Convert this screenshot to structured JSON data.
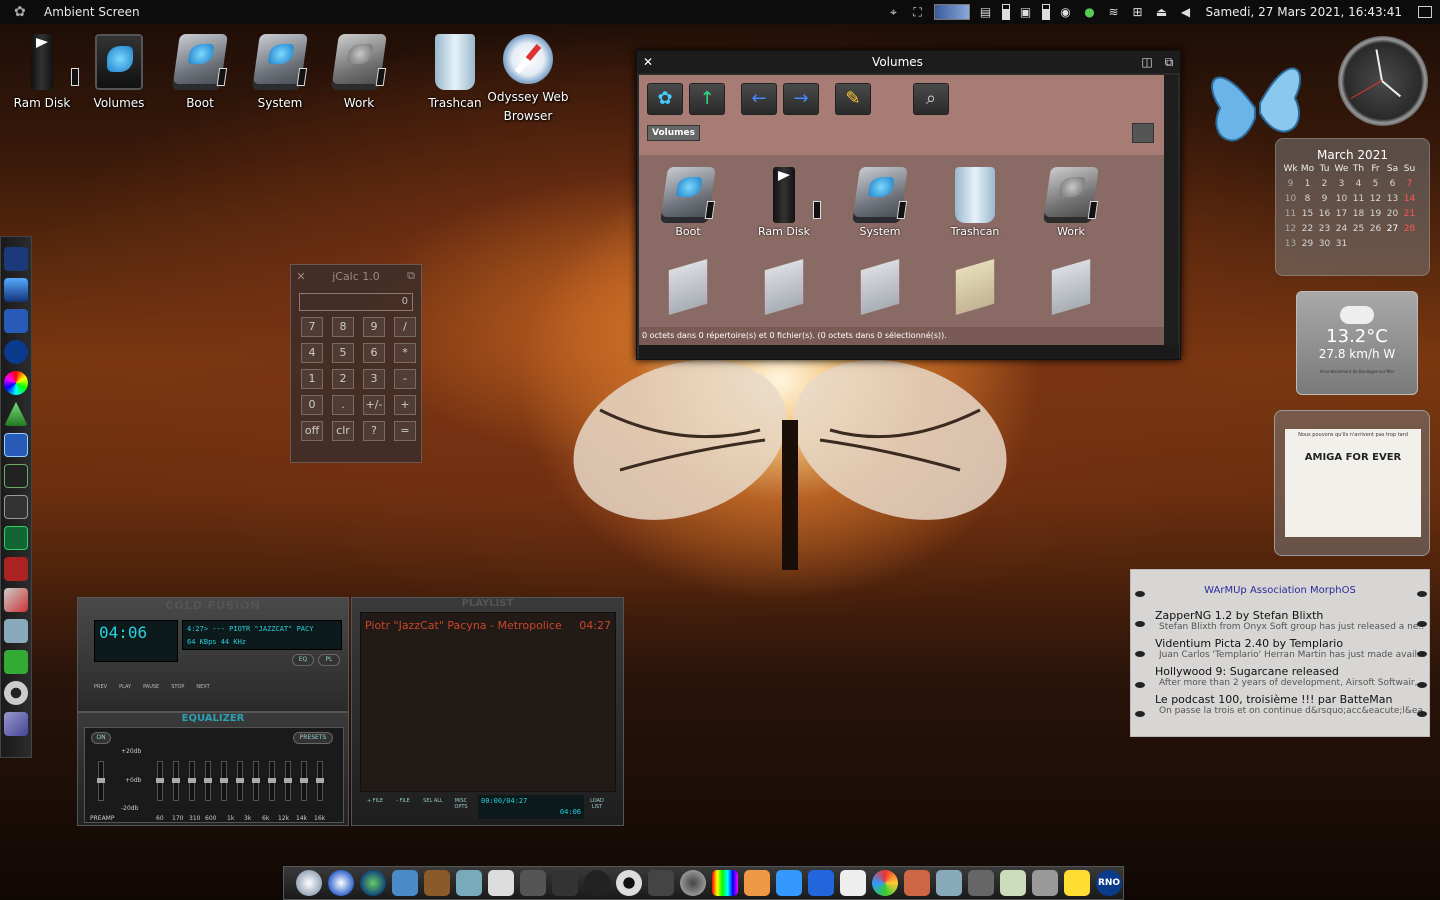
{
  "topbar": {
    "title": "Ambient Screen",
    "datetime": "Samedi, 27 Mars 2021, 16:43:41",
    "icons": [
      "butterfly-menu-icon",
      "antenna-icon",
      "screen-capture-icon",
      "cpu-meter-icon",
      "memory-icon",
      "battery-icon",
      "drive-icon",
      "mail-icon",
      "network-status-icon",
      "wifi-icon",
      "network-icon",
      "eject-icon",
      "volume-icon",
      "windows-icon"
    ]
  },
  "desktop_icons": [
    {
      "label": "Ram Disk",
      "icon": "ram-disk-icon"
    },
    {
      "label": "Volumes",
      "icon": "volumes-icon"
    },
    {
      "label": "Boot",
      "icon": "drive-icon"
    },
    {
      "label": "System",
      "icon": "drive-icon"
    },
    {
      "label": "Work",
      "icon": "drive-icon"
    },
    {
      "label": "Trashcan",
      "icon": "trashcan-icon"
    },
    {
      "label": "Odyssey Web Browser",
      "icon": "odyssey-icon"
    }
  ],
  "jcalc": {
    "title": "jCalc 1.0",
    "display": "0",
    "keys": [
      "7",
      "8",
      "9",
      "/",
      "4",
      "5",
      "6",
      "*",
      "1",
      "2",
      "3",
      "-",
      "0",
      ".",
      "+/-",
      "+",
      "off",
      "clr",
      "?",
      "="
    ]
  },
  "volumes_window": {
    "title": "Volumes",
    "tab": "Volumes",
    "items": [
      {
        "label": "Boot",
        "icon": "drive-icon"
      },
      {
        "label": "Ram Disk",
        "icon": "ram-disk-icon"
      },
      {
        "label": "System",
        "icon": "drive-icon"
      },
      {
        "label": "Trashcan",
        "icon": "trashcan-icon"
      },
      {
        "label": "Work",
        "icon": "drive-icon"
      }
    ],
    "status": "0 octets dans 0 répertoire(s) et 0 fichier(s). (0 octets dans 0 sélectionné(s))."
  },
  "calendar": {
    "month": "March 2021",
    "header": [
      "Wk",
      "Mo",
      "Tu",
      "We",
      "Th",
      "Fr",
      "Sa",
      "Su"
    ],
    "rows": [
      [
        "9",
        "1",
        "2",
        "3",
        "4",
        "5",
        "6",
        "7"
      ],
      [
        "10",
        "8",
        "9",
        "10",
        "11",
        "12",
        "13",
        "14"
      ],
      [
        "11",
        "15",
        "16",
        "17",
        "18",
        "19",
        "20",
        "21"
      ],
      [
        "12",
        "22",
        "23",
        "24",
        "25",
        "26",
        "27",
        "28"
      ],
      [
        "13",
        "29",
        "30",
        "31",
        "",
        "",
        "",
        ""
      ]
    ],
    "today": "27"
  },
  "weather": {
    "temperature": "13.2°C",
    "wind": "27.8 km/h W",
    "location": "Arrondissement de Boulogne-sur-Mer"
  },
  "comic": {
    "caption": "Nous pouvons qu'ils n'arrivent pas trop tard",
    "title": "AMIGA FOR EVER"
  },
  "news": {
    "header": "WArMUp Association MorphOS",
    "items": [
      {
        "title": "ZapperNG 1.2 by Stefan Blixth",
        "desc": "Stefan Blixth from Onyx Soft group has just released a ne..."
      },
      {
        "title": "Videntium Picta 2.40 by Templario",
        "desc": "Juan Carlos 'Templario' Herran Martin has just made avail..."
      },
      {
        "title": "Hollywood 9: Sugarcane released",
        "desc": "After more than 2 years of development, Airsoft Softwair,..."
      },
      {
        "title": "Le podcast 100, troisième !!! par BatteMan",
        "desc": "On passe la trois et on continue d&rsquo;acc&eacute;l&ea..."
      }
    ]
  },
  "player": {
    "title": "COLD FUSION",
    "time": "04:06",
    "track_info": "4:27> --- PIOTR \"JAZZCAT\" PACY",
    "bitrate": "64 KBps  44 KHz",
    "controls": [
      "PREV",
      "PLAY",
      "PAUSE",
      "STOP",
      "NEXT"
    ],
    "eq_btn": "EQ",
    "pl_btn": "PL"
  },
  "equalizer": {
    "title": "EQUALIZER",
    "on": "ON",
    "presets": "PRESETS",
    "db_high": "+20db",
    "db_mid": "+0db",
    "db_low": "-20db",
    "bands": [
      "PREAMP",
      "60",
      "170",
      "310",
      "600",
      "1k",
      "3k",
      "6k",
      "12k",
      "14k",
      "16k"
    ]
  },
  "playlist": {
    "title": "PLAYLIST",
    "rows": [
      {
        "track": "Piotr \"JazzCat\" Pacyna - Metropolice",
        "duration": "04:27"
      }
    ],
    "buttons": [
      "+ FILE",
      "- FILE",
      "SEL ALL",
      "MISC OPTS",
      "LOAD LIST"
    ],
    "time": "00:00/04:27",
    "elapsed": "04:06"
  },
  "left_dock": [
    "terminal-icon",
    "shoe-icon",
    "paint-icon",
    "rno-icon",
    "color-wheel-icon",
    "triangle-icon",
    "window-icon",
    "monitor-icon",
    "calculator-icon",
    "oscilloscope-icon",
    "help-icon",
    "tools-icon",
    "usb-icon",
    "download-icon",
    "gear-icon",
    "feather-icon"
  ],
  "bottom_dock": [
    "clock-icon",
    "compass-icon",
    "globe-icon",
    "monitor-icon",
    "character-icon",
    "package-icon",
    "web-icon",
    "music-icon",
    "mixer-icon",
    "headphones-icon",
    "speaker-icon",
    "camera-icon",
    "disc-icon",
    "equalizer-icon",
    "pen-icon",
    "butterfly-icon",
    "cube-icon",
    "p-icon",
    "palette-icon",
    "painting-icon",
    "photo-icon",
    "microscope-icon",
    "map-icon",
    "calculator-icon",
    "lightning-icon",
    "rno-icon"
  ],
  "colors": {
    "accent": "#2ad0e0",
    "window_bg": "#8a6a64",
    "toolbar_bg": "#a67c74",
    "playlist_text": "#c8462a"
  }
}
